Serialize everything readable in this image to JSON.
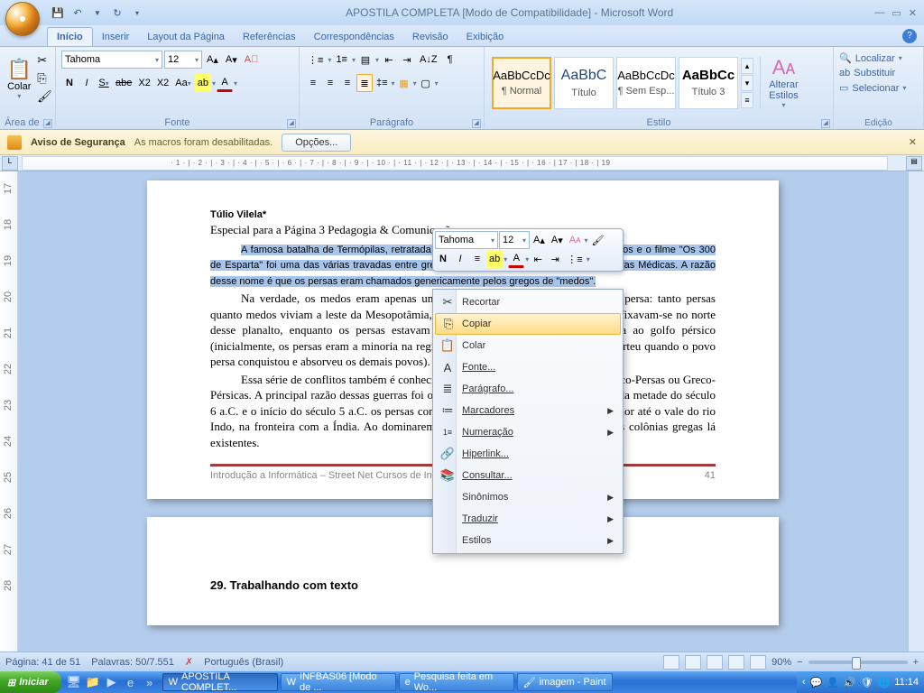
{
  "title": "APOSTILA COMPLETA [Modo de Compatibilidade] - Microsoft Word",
  "tabs": [
    "Início",
    "Inserir",
    "Layout da Página",
    "Referências",
    "Correspondências",
    "Revisão",
    "Exibição"
  ],
  "clipboard": {
    "paste": "Colar",
    "group": "Área de ..."
  },
  "font": {
    "name": "Tahoma",
    "size": "12",
    "group": "Fonte"
  },
  "paragraph": {
    "group": "Parágrafo"
  },
  "styles": {
    "group": "Estilo",
    "tiles": [
      {
        "prev": "AaBbCcDc",
        "label": "¶ Normal",
        "selected": true
      },
      {
        "prev": "AaBbC",
        "label": "Título",
        "selected": false
      },
      {
        "prev": "AaBbCcDc",
        "label": "¶ Sem Esp...",
        "selected": false
      },
      {
        "prev": "AaBbCc",
        "label": "Título 3",
        "selected": false
      }
    ],
    "change": "Alterar Estilos"
  },
  "editing": {
    "group": "Edição",
    "find": "Localizar",
    "replace": "Substituir",
    "select": "Selecionar"
  },
  "security": {
    "title": "Aviso de Segurança",
    "msg": "As macros foram desabilitadas.",
    "btn": "Opções..."
  },
  "ruler_marks": "· 1 · | · 2 · | · 3 · | · 4 · | · 5 · | · 6 · | · 7 · | · 8 · | · 9 · | · 10 · | · 11 · | · 12 · | · 13 · | · 14 · | · 15 · | · 16 · | 17 · | 18 · | 19",
  "vruler": [
    "17",
    "18",
    "19",
    "20",
    "21",
    "22",
    "23",
    "24",
    "25",
    "26",
    "27",
    "28"
  ],
  "doc": {
    "title": "Túlio Vilela*",
    "sub": "Especial para a Página 3 Pedagogia & Comunicação",
    "p1a": "A famosa batalha de Termópilas, retratada recentemente para a história em quadrinhos e o filme \"Os 300 de Esparta\" foi uma das várias travadas entre gregos e persas durante as chamadas Guerras Médicas. A razão desse nome é que os persas eram chamados genericamente pelos gregos de \"medos\".",
    "p2a": "Na verdade, os medos eram apenas um dos povos que formavam o Império persa: tanto persas quanto medos viviam a leste da Mesopotâmia, habitando o planalto do Irã, os medos fixavam-se no norte desse planalto, enquanto os persas estavam localizados na parte sudeste, próxima ao golfo pérsico (inicialmente, os persas eram a minoria na região em que viviam, situação que se inverteu quando o povo persa conquistou e absorveu os demais povos).",
    "p3": "Essa série de conflitos também é conhecida como Guerras Pérsicas, Guerras Greco-Persas ou Greco-Pérsicas. A principal razão dessas guerras foi o expansionismo persa. Durante a segunda metade do século 6 a.C. e o início do século 5 a.C. os persas conquistaram todo o território da Ásia Menor até o vale do rio Indo, na fronteira com a Índia. Ao dominarem a Ásia Menor, os persas oprimiram as colônias gregas lá existentes.",
    "footer_l": "Introdução a Informática – Street Net Cursos de Informática",
    "footer_r": "41",
    "page2_h": "29.   Trabalhando com texto"
  },
  "minitb": {
    "font": "Tahoma",
    "size": "12"
  },
  "context": [
    {
      "icon": "✂",
      "label": "Recortar"
    },
    {
      "icon": "⎘",
      "label": "Copiar",
      "hot": true
    },
    {
      "icon": "📋",
      "label": "Colar"
    },
    {
      "icon": "A",
      "label": "Fonte..."
    },
    {
      "icon": "≣",
      "label": "Parágrafo..."
    },
    {
      "icon": "≔",
      "label": "Marcadores",
      "sub": true
    },
    {
      "icon": "1≡",
      "label": "Numeração",
      "sub": true
    },
    {
      "icon": "🔗",
      "label": "Hiperlink..."
    },
    {
      "icon": "📚",
      "label": "Consultar..."
    },
    {
      "icon": "",
      "label": "Sinônimos",
      "sub": true
    },
    {
      "icon": "",
      "label": "Traduzir",
      "sub": true
    },
    {
      "icon": "",
      "label": "Estilos",
      "sub": true
    }
  ],
  "status": {
    "page": "Página: 41 de 51",
    "words": "Palavras: 50/7.551",
    "lang": "Português (Brasil)",
    "zoom": "90%"
  },
  "taskbar": {
    "start": "Iniciar",
    "items": [
      {
        "icon": "W",
        "label": "APOSTILA COMPLET...",
        "active": true
      },
      {
        "icon": "W",
        "label": "INFBAS06 [Modo de ..."
      },
      {
        "icon": "e",
        "label": "Pesquisa feita em Wo..."
      },
      {
        "icon": "🖌",
        "label": "imagem - Paint"
      }
    ],
    "clock": "11:14"
  }
}
